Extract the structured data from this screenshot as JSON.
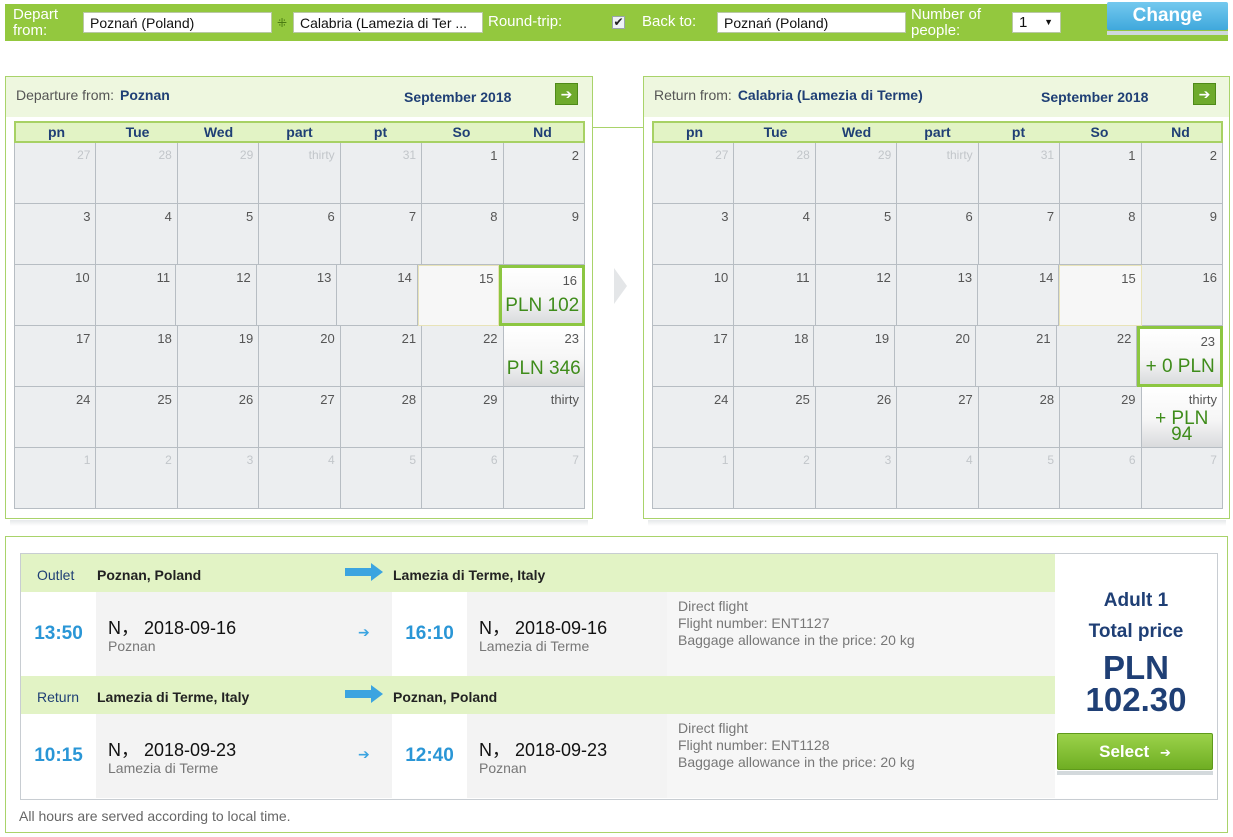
{
  "search": {
    "depart_label_1": "Depart",
    "depart_label_2": "from:",
    "from_value": "Poznań (Poland)",
    "to_value": "Calabria (Lamezia di Ter ...",
    "roundtrip_label": "Round-trip:",
    "roundtrip_checked": "✔",
    "back_to_label": "Back to:",
    "back_to_value": "Poznań (Poland)",
    "people_label_1": "Number of",
    "people_label_2": "people:",
    "people_value": "1",
    "change_label": "Change"
  },
  "calendar_days": [
    "pn",
    "Tue",
    "Wed",
    "part",
    "pt",
    "So",
    "Nd"
  ],
  "departure": {
    "label": "Departure from:",
    "city": "Poznan",
    "month": "September 2018",
    "rows": [
      [
        [
          "27",
          "",
          1
        ],
        [
          "28",
          "",
          1
        ],
        [
          "29",
          "",
          1
        ],
        [
          "thirty",
          "",
          1
        ],
        [
          "31",
          "",
          1
        ],
        [
          "1",
          "",
          0
        ],
        [
          "2",
          "",
          0
        ]
      ],
      [
        [
          "3",
          "",
          0
        ],
        [
          "4",
          "",
          0
        ],
        [
          "5",
          "",
          0
        ],
        [
          "6",
          "",
          0
        ],
        [
          "7",
          "",
          0
        ],
        [
          "8",
          "",
          0
        ],
        [
          "9",
          "",
          0
        ]
      ],
      [
        [
          "10",
          "",
          0
        ],
        [
          "11",
          "",
          0
        ],
        [
          "12",
          "",
          0
        ],
        [
          "13",
          "",
          0
        ],
        [
          "14",
          "",
          0
        ],
        [
          "15",
          "",
          2
        ],
        [
          "16",
          "PLN 102",
          4
        ]
      ],
      [
        [
          "17",
          "",
          0
        ],
        [
          "18",
          "",
          0
        ],
        [
          "19",
          "",
          0
        ],
        [
          "20",
          "",
          0
        ],
        [
          "21",
          "",
          0
        ],
        [
          "22",
          "",
          0
        ],
        [
          "23",
          "PLN 346",
          3
        ]
      ],
      [
        [
          "24",
          "",
          0
        ],
        [
          "25",
          "",
          0
        ],
        [
          "26",
          "",
          0
        ],
        [
          "27",
          "",
          0
        ],
        [
          "28",
          "",
          0
        ],
        [
          "29",
          "",
          0
        ],
        [
          "thirty",
          "",
          0
        ]
      ],
      [
        [
          "1",
          "",
          1
        ],
        [
          "2",
          "",
          1
        ],
        [
          "3",
          "",
          1
        ],
        [
          "4",
          "",
          1
        ],
        [
          "5",
          "",
          1
        ],
        [
          "6",
          "",
          1
        ],
        [
          "7",
          "",
          1
        ]
      ]
    ]
  },
  "return": {
    "label": "Return from:",
    "city": "Calabria (Lamezia di Terme)",
    "month": "September 2018",
    "rows": [
      [
        [
          "27",
          "",
          1
        ],
        [
          "28",
          "",
          1
        ],
        [
          "29",
          "",
          1
        ],
        [
          "thirty",
          "",
          1
        ],
        [
          "31",
          "",
          1
        ],
        [
          "1",
          "",
          0
        ],
        [
          "2",
          "",
          0
        ]
      ],
      [
        [
          "3",
          "",
          0
        ],
        [
          "4",
          "",
          0
        ],
        [
          "5",
          "",
          0
        ],
        [
          "6",
          "",
          0
        ],
        [
          "7",
          "",
          0
        ],
        [
          "8",
          "",
          0
        ],
        [
          "9",
          "",
          0
        ]
      ],
      [
        [
          "10",
          "",
          0
        ],
        [
          "11",
          "",
          0
        ],
        [
          "12",
          "",
          0
        ],
        [
          "13",
          "",
          0
        ],
        [
          "14",
          "",
          0
        ],
        [
          "15",
          "",
          2
        ],
        [
          "16",
          "",
          0
        ]
      ],
      [
        [
          "17",
          "",
          0
        ],
        [
          "18",
          "",
          0
        ],
        [
          "19",
          "",
          0
        ],
        [
          "20",
          "",
          0
        ],
        [
          "21",
          "",
          0
        ],
        [
          "22",
          "",
          0
        ],
        [
          "23",
          "+ 0 PLN",
          4
        ]
      ],
      [
        [
          "24",
          "",
          0
        ],
        [
          "25",
          "",
          0
        ],
        [
          "26",
          "",
          0
        ],
        [
          "27",
          "",
          0
        ],
        [
          "28",
          "",
          0
        ],
        [
          "29",
          "",
          0
        ],
        [
          "thirty",
          "+ PLN 94",
          3
        ]
      ],
      [
        [
          "1",
          "",
          1
        ],
        [
          "2",
          "",
          1
        ],
        [
          "3",
          "",
          1
        ],
        [
          "4",
          "",
          1
        ],
        [
          "5",
          "",
          1
        ],
        [
          "6",
          "",
          1
        ],
        [
          "7",
          "",
          1
        ]
      ]
    ]
  },
  "outbound": {
    "kind": "Outlet",
    "from": "Poznan, Poland",
    "to": "Lamezia di Terme, Italy",
    "dep_time": "13:50",
    "dep_date": "N， 2018-09-16",
    "dep_place": "Poznan",
    "arr_time": "16:10",
    "arr_date": "N， 2018-09-16",
    "arr_place": "Lamezia di Terme",
    "detail_1": "Direct flight",
    "detail_2": "Flight number: ENT1127",
    "detail_3": "Baggage allowance in the price: 20 kg"
  },
  "inbound": {
    "kind": "Return",
    "from": "Lamezia di Terme, Italy",
    "to": "Poznan, Poland",
    "dep_time": "10:15",
    "dep_date": "N， 2018-09-23",
    "dep_place": "Lamezia di Terme",
    "arr_time": "12:40",
    "arr_date": "N， 2018-09-23",
    "arr_place": "Poznan",
    "detail_1": "Direct flight",
    "detail_2": "Flight number: ENT1128",
    "detail_3": "Baggage allowance in the price: 20 kg"
  },
  "price": {
    "adult": "Adult 1",
    "total_label": "Total price",
    "currency": "PLN",
    "amount": "102.30",
    "select_label": "Select"
  },
  "footnote": "All hours are served according to local time.",
  "colors": {
    "brand_green": "#93c83e",
    "navy": "#1f3f75",
    "time_blue": "#2a96d6",
    "price_green": "#3f8c1b"
  },
  "icons": {
    "next_month": "arrow-right-icon",
    "flight_direction": "arrow-right-icon"
  }
}
